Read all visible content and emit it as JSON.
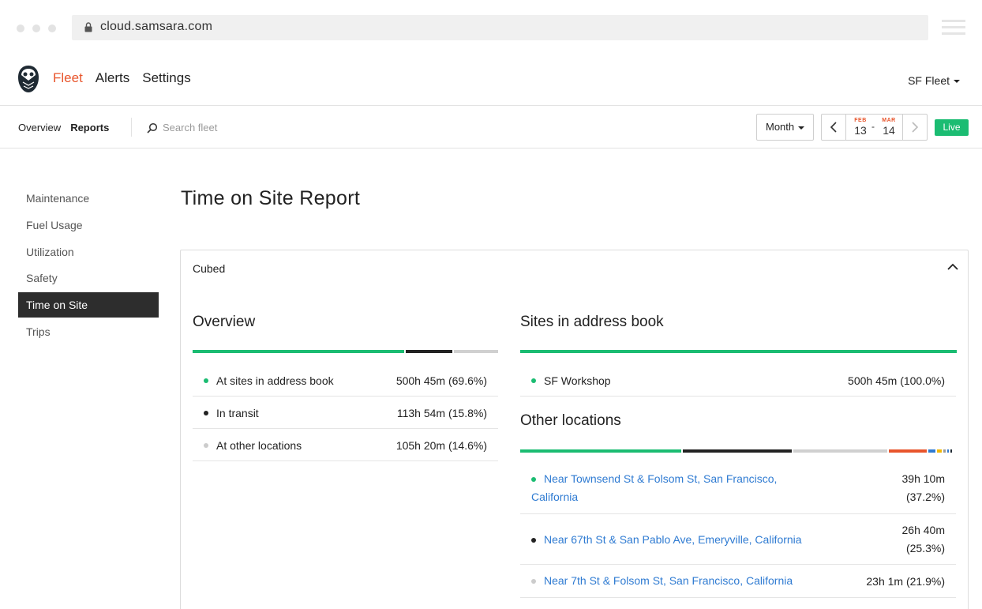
{
  "browser": {
    "url": "cloud.samsara.com"
  },
  "header": {
    "nav": [
      {
        "label": "Fleet",
        "active": true
      },
      {
        "label": "Alerts",
        "active": false
      },
      {
        "label": "Settings",
        "active": false
      }
    ],
    "fleet_select": "SF Fleet"
  },
  "subheader": {
    "tabs": [
      {
        "label": "Overview",
        "active": false
      },
      {
        "label": "Reports",
        "active": true
      }
    ],
    "search_placeholder": "Search fleet",
    "period": "Month",
    "date_start": {
      "month": "FEB",
      "day": "13"
    },
    "date_separator": "-",
    "date_end": {
      "month": "MAR",
      "day": "14"
    },
    "live_label": "Live"
  },
  "sidebar": {
    "items": [
      {
        "label": "Maintenance",
        "active": false
      },
      {
        "label": "Fuel Usage",
        "active": false
      },
      {
        "label": "Utilization",
        "active": false
      },
      {
        "label": "Safety",
        "active": false
      },
      {
        "label": "Time on Site",
        "active": true
      },
      {
        "label": "Trips",
        "active": false
      }
    ]
  },
  "main": {
    "title": "Time on Site Report",
    "card": {
      "title": "Cubed",
      "overview": {
        "title": "Overview",
        "rows": [
          {
            "label": "At sites in address book",
            "value": "500h 45m (69.6%)",
            "color": "#1bbc72"
          },
          {
            "label": "In transit",
            "value": "113h 54m (15.8%)",
            "color": "#222222"
          },
          {
            "label": "At other locations",
            "value": "105h 20m (14.6%)",
            "color": "#cccccc"
          }
        ]
      },
      "sites": {
        "title": "Sites in address book",
        "rows": [
          {
            "label": "SF Workshop",
            "value": "500h 45m (100.0%)",
            "color": "#1bbc72"
          }
        ]
      },
      "other_locations": {
        "title": "Other locations",
        "rows": [
          {
            "label": "Near Townsend St & Folsom St, San Francisco, California",
            "value": "39h 10m (37.2%)",
            "color": "#1bbc72"
          },
          {
            "label": "Near 67th St & San Pablo Ave, Emeryville, California",
            "value": "26h 40m (25.3%)",
            "color": "#222222"
          },
          {
            "label": "Near 7th St & Folsom St, San Francisco, California",
            "value": "23h 1m (21.9%)",
            "color": "#cccccc"
          }
        ]
      }
    }
  },
  "colors": {
    "accent": "#e8552c",
    "green": "#1bbc72",
    "link": "#2f7bd2",
    "orange": "#e8552c",
    "blue": "#2f7bd2",
    "yellow": "#f2b705"
  }
}
